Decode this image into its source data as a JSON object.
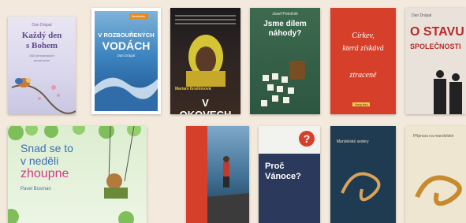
{
  "books": [
    {
      "author": "Dan Drápal",
      "title_line1": "Každý den",
      "title_line2": "s Bohem",
      "subtitle_line1": "365 křesťanských",
      "subtitle_line2": "povzbuzení"
    },
    {
      "badge": "Bestseller",
      "title_line1": "V ROZBOUŘENÝCH",
      "title_line2": "VODÁCH",
      "author": "Dan Drápal"
    },
    {
      "author": "Mariam Ibrahimová",
      "title": "V OKOVECH"
    },
    {
      "author": "Josef Potočník",
      "title_line1": "Jsme dílem",
      "title_line2": "náhody?"
    },
    {
      "title_line1": "Církev,",
      "title_line2": "která získává",
      "title_line3": "ztracené",
      "badge": "Nový titul"
    },
    {
      "author": "Dan Drápal",
      "title_line1": "O STAVU",
      "title_line2": "SPOLEČNOSTI"
    },
    {
      "title_line1": "Snad se to",
      "title_line2": "v neděli",
      "title_line3": "zhoupne",
      "author": "Pavel Bosman"
    },
    {},
    {
      "title_line1": "Proč",
      "title_line2": "Vánoce?"
    },
    {
      "title": "Mandelské sedery"
    },
    {
      "title": "Příprava na mandelské"
    }
  ],
  "colors": {
    "page_bg": "#f3e9dc",
    "navy": "#2b3a5c",
    "red": "#d6402a"
  }
}
